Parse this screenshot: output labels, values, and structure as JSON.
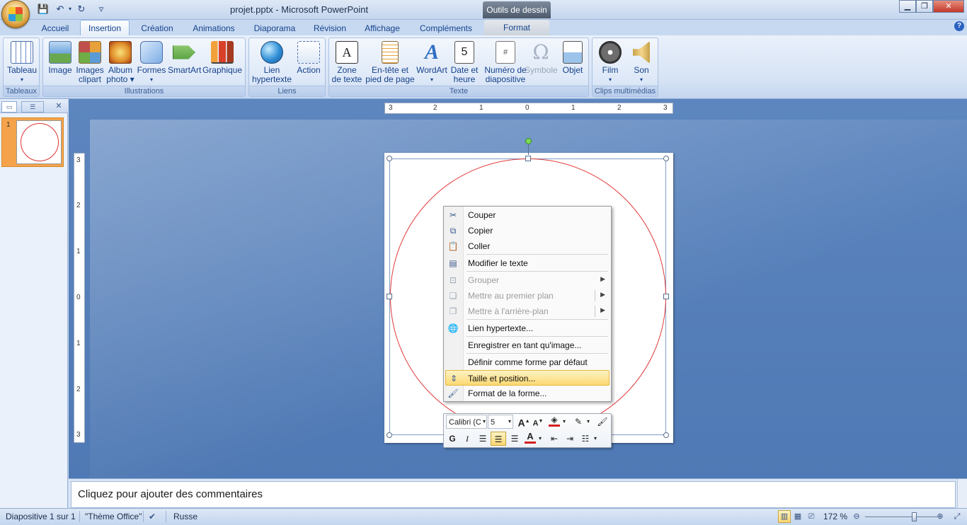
{
  "titlebar": {
    "title": "projet.pptx - Microsoft PowerPoint",
    "context_tools": "Outils de dessin",
    "quick_access": {
      "save_icon": "save-icon",
      "undo_icon": "undo-icon",
      "redo_icon": "redo-icon",
      "customize": "▿"
    }
  },
  "tabs": [
    {
      "label": "Accueil"
    },
    {
      "label": "Insertion",
      "active": true
    },
    {
      "label": "Création"
    },
    {
      "label": "Animations"
    },
    {
      "label": "Diaporama"
    },
    {
      "label": "Révision"
    },
    {
      "label": "Affichage"
    },
    {
      "label": "Compléments"
    },
    {
      "label": "Format"
    }
  ],
  "ribbon": {
    "groups": {
      "tableaux": "Tableaux",
      "illustrations": "Illustrations",
      "liens": "Liens",
      "texte": "Texte",
      "clips": "Clips multimédias"
    },
    "buttons": {
      "tableau": "Tableau",
      "image": "Image",
      "images_clipart_1": "Images",
      "images_clipart_2": "clipart",
      "album_1": "Album",
      "album_2": "photo",
      "formes": "Formes",
      "smartart": "SmartArt",
      "graphique": "Graphique",
      "lien_1": "Lien",
      "lien_2": "hypertexte",
      "action": "Action",
      "zone_1": "Zone",
      "zone_2": "de texte",
      "entete_1": "En-tête et",
      "entete_2": "pied de page",
      "wordart": "WordArt",
      "date_1": "Date et",
      "date_2": "heure",
      "numero_1": "Numéro de",
      "numero_2": "diapositive",
      "symbole": "Symbole",
      "objet": "Objet",
      "film": "Film",
      "son": "Son"
    }
  },
  "leftpane": {
    "slide_number": "1"
  },
  "ruler": {
    "h_ticks": [
      "3",
      "2",
      "1",
      "0",
      "1",
      "2",
      "3"
    ],
    "v_ticks": [
      "3",
      "2",
      "1",
      "0",
      "1",
      "2",
      "3"
    ]
  },
  "context_menu": {
    "items": [
      {
        "label": "Couper",
        "icon": "scissors-icon"
      },
      {
        "label": "Copier",
        "icon": "copy-icon"
      },
      {
        "label": "Coller",
        "icon": "paste-icon"
      },
      {
        "label": "Modifier le texte",
        "icon": "edit-text-icon"
      },
      {
        "label": "Grouper",
        "icon": "group-icon",
        "disabled": true,
        "submenu": true
      },
      {
        "label": "Mettre au premier plan",
        "icon": "bring-front-icon",
        "disabled": true,
        "submenu": true
      },
      {
        "label": "Mettre à l'arrière-plan",
        "icon": "send-back-icon",
        "disabled": true,
        "submenu": true
      },
      {
        "label": "Lien hypertexte...",
        "icon": "hyperlink-icon"
      },
      {
        "label": "Enregistrer en tant qu'image..."
      },
      {
        "label": "Définir comme forme par défaut"
      },
      {
        "label": "Taille et position...",
        "icon": "size-position-icon",
        "highlighted": true
      },
      {
        "label": "Format de la forme...",
        "icon": "format-shape-icon"
      }
    ]
  },
  "mini_toolbar": {
    "font": "Calibri (C",
    "size": "5",
    "bold": "G",
    "italic": "I",
    "font_color": "#d32020",
    "fill_color": "#d32020"
  },
  "notes": {
    "placeholder": "Cliquez pour ajouter des commentaires"
  },
  "statusbar": {
    "slide_info": "Diapositive 1 sur 1",
    "theme": "\"Thème Office\"",
    "language": "Russe",
    "zoom": "172 %",
    "zoom_level_percent": 172
  }
}
